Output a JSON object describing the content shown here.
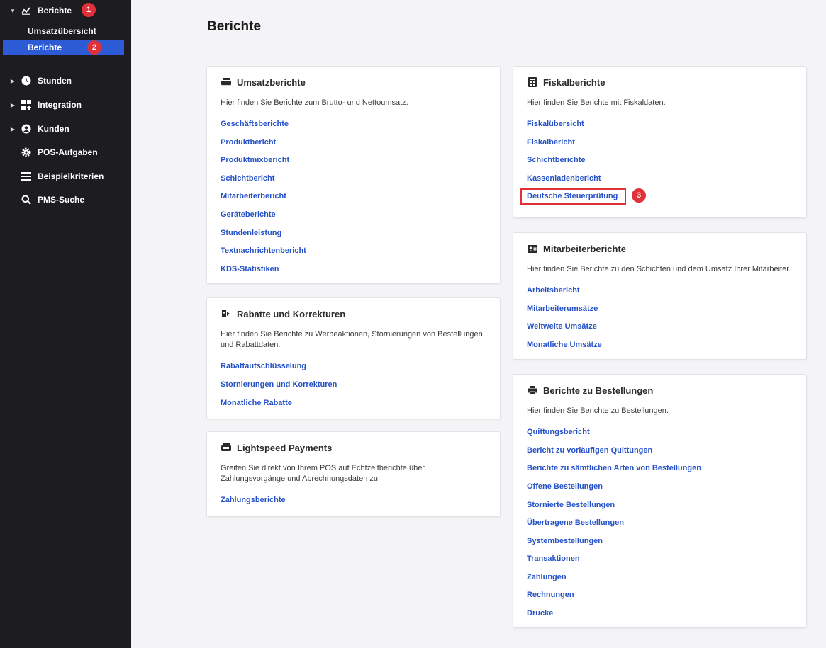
{
  "sidebar": {
    "berichte_label": "Berichte",
    "sub_items": [
      "Umsatzübersicht",
      "Berichte"
    ],
    "items": [
      {
        "label": "Stunden",
        "icon": "clock-icon"
      },
      {
        "label": "Integration",
        "icon": "grid-plus-icon"
      },
      {
        "label": "Kunden",
        "icon": "user-circle-icon"
      },
      {
        "label": "POS-Aufgaben",
        "icon": "gear-icon"
      },
      {
        "label": "Beispielkriterien",
        "icon": "list-icon"
      },
      {
        "label": "PMS-Suche",
        "icon": "search-icon"
      }
    ]
  },
  "badges": [
    "1",
    "2",
    "3"
  ],
  "page": {
    "title": "Berichte"
  },
  "cards": {
    "umsatz": {
      "title": "Umsatzberichte",
      "description": "Hier finden Sie Berichte zum Brutto- und Nettoumsatz.",
      "links": [
        "Geschäftsberichte",
        "Produktbericht",
        "Produktmixbericht",
        "Schichtbericht",
        "Mitarbeiterbericht",
        "Geräteberichte",
        "Stundenleistung",
        "Textnachrichtenbericht",
        "KDS-Statistiken"
      ]
    },
    "rabatte": {
      "title": "Rabatte und Korrekturen",
      "description_1": "Hier finden Sie Berichte zu Werbeaktionen, Stornierungen von Bestellungen",
      "description_2": "und Rabattdaten.",
      "links": [
        "Rabattaufschlüsselung",
        "Stornierungen und Korrekturen",
        "Monatliche Rabatte"
      ]
    },
    "payments": {
      "title": "Lightspeed Payments",
      "description_1": "Greifen Sie direkt von Ihrem POS auf Echtzeitberichte über",
      "description_2": "Zahlungsvorgänge und Abrechnungsdaten zu.",
      "links": [
        "Zahlungsberichte"
      ]
    },
    "fiskal": {
      "title": "Fiskalberichte",
      "description": "Hier finden Sie Berichte mit Fiskaldaten.",
      "links": [
        "Fiskalübersicht",
        "Fiskalbericht",
        "Schichtberichte",
        "Kassenladenbericht",
        "Deutsche Steuerprüfung"
      ]
    },
    "mitarbeiter": {
      "title": "Mitarbeiterberichte",
      "description": "Hier finden Sie Berichte zu den Schichten und dem Umsatz Ihrer Mitarbeiter.",
      "links": [
        "Arbeitsbericht",
        "Mitarbeiterumsätze",
        "Weltweite Umsätze",
        "Monatliche Umsätze"
      ]
    },
    "bestellungen": {
      "title": "Berichte zu Bestellungen",
      "description": "Hier finden Sie Berichte zu Bestellungen.",
      "links": [
        "Quittungsbericht",
        "Bericht zu vorläufigen Quittungen",
        "Berichte zu sämtlichen Arten von Bestellungen",
        "Offene Bestellungen",
        "Stornierte Bestellungen",
        "Übertragene Bestellungen",
        "Systembestellungen",
        "Transaktionen",
        "Zahlungen",
        "Rechnungen",
        "Drucke"
      ]
    }
  },
  "colors": {
    "sidebar_bg": "#1c1c21",
    "active": "#2d5bd6",
    "link": "#2552c8",
    "badge": "#e0303a",
    "page_bg": "#f4f4f6"
  }
}
